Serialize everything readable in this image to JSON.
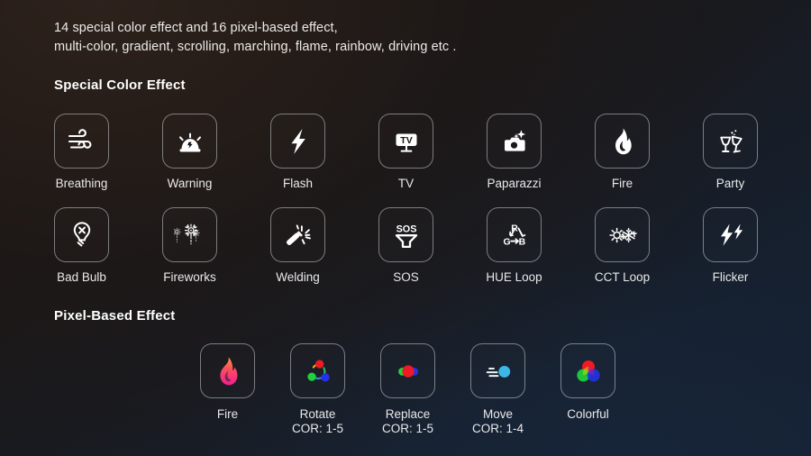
{
  "intro": {
    "line1": "14 special color effect and 16 pixel-based effect,",
    "line2": "multi-color, gradient, scrolling, marching, flame, rainbow, driving etc ."
  },
  "sections": {
    "special": {
      "title": "Special Color Effect",
      "rows": [
        [
          {
            "label": "Breathing",
            "icon": "wind-icon"
          },
          {
            "label": "Warning",
            "icon": "siren-icon"
          },
          {
            "label": "Flash",
            "icon": "lightning-bolt-icon"
          },
          {
            "label": "TV",
            "icon": "tv-icon"
          },
          {
            "label": "Paparazzi",
            "icon": "camera-sparkle-icon"
          },
          {
            "label": "Fire",
            "icon": "flame-icon"
          },
          {
            "label": "Party",
            "icon": "cheers-glasses-icon"
          }
        ],
        [
          {
            "label": "Bad Bulb",
            "icon": "broken-bulb-icon"
          },
          {
            "label": "Fireworks",
            "icon": "fireworks-icon"
          },
          {
            "label": "Welding",
            "icon": "welding-torch-icon"
          },
          {
            "label": "SOS",
            "icon": "sos-horn-icon"
          },
          {
            "label": "HUE Loop",
            "icon": "rgb-loop-icon"
          },
          {
            "label": "CCT Loop",
            "icon": "sun-snowflake-icon"
          },
          {
            "label": "Flicker",
            "icon": "double-bolt-icon"
          }
        ]
      ]
    },
    "pixel": {
      "title": "Pixel-Based Effect",
      "rows": [
        [
          {
            "label": "Fire",
            "sub": "",
            "icon": "gradient-flame-icon"
          },
          {
            "label": "Rotate",
            "sub": "COR: 1-5",
            "icon": "rgb-rotate-icon"
          },
          {
            "label": "Replace",
            "sub": "COR: 1-5",
            "icon": "rgb-replace-icon"
          },
          {
            "label": "Move",
            "sub": "COR: 1-4",
            "icon": "motion-dot-icon"
          },
          {
            "label": "Colorful",
            "sub": "",
            "icon": "rgb-venn-icon"
          }
        ]
      ]
    }
  },
  "colors": {
    "background_top_left": "#1d1715",
    "background_bottom_right": "#16202f",
    "text": "#eceae8",
    "icon_stroke": "#ffffff",
    "tile_border": "#c8cdd4",
    "red": "#ee1b24",
    "green": "#1fd23a",
    "blue": "#2433e8",
    "cyan": "#3bb8e8",
    "flame_top": "#ff8a3d",
    "flame_bottom": "#f02b86"
  }
}
